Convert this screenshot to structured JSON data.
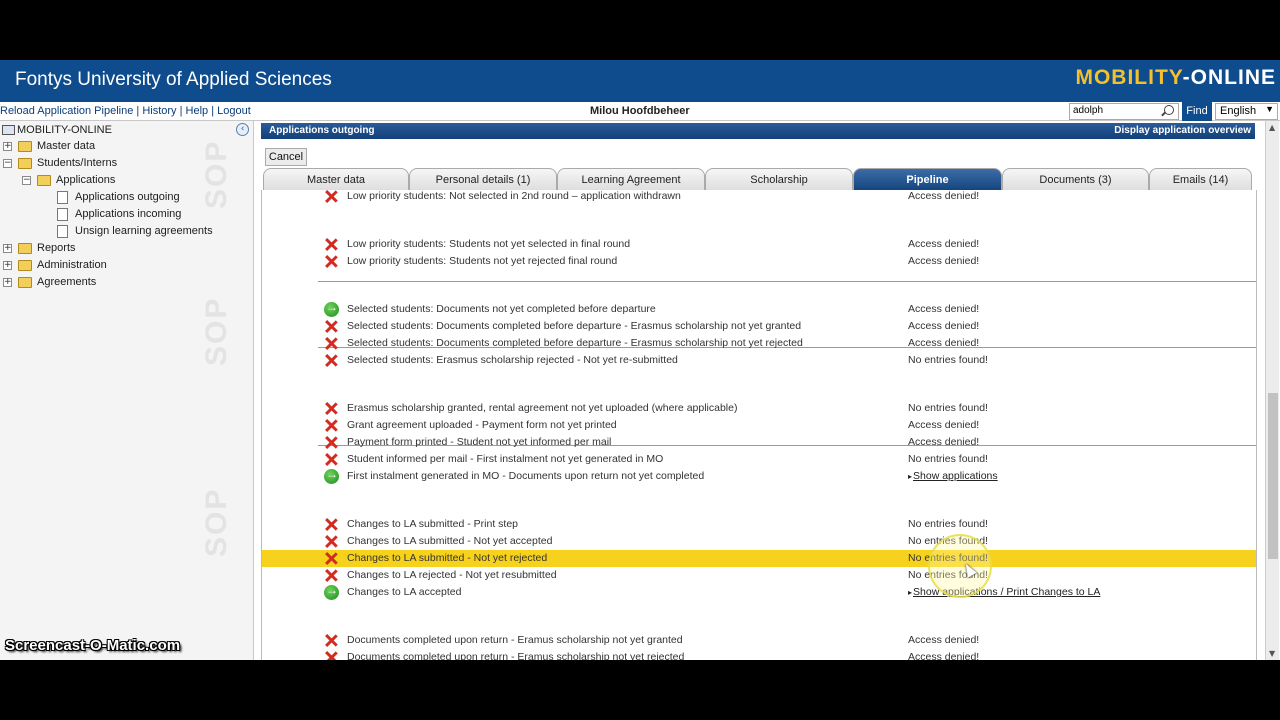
{
  "banner": {
    "title": "Fontys University of Applied Sciences",
    "logo_part1": "MOBILITY",
    "logo_dash": "-",
    "logo_part2": "ONLINE"
  },
  "topbar": {
    "links": [
      "Reload Application Pipeline",
      "History",
      "Help",
      "Logout"
    ],
    "user": "Milou Hoofdbeheer",
    "search_value": "adolph",
    "find_label": "Find",
    "language": "English"
  },
  "sidebar": {
    "root": "MOBILITY-ONLINE",
    "items": [
      "Master data",
      "Students/Interns",
      "Applications",
      "Applications outgoing",
      "Applications incoming",
      "Unsign learning agreements",
      "Reports",
      "Administration",
      "Agreements"
    ],
    "watermark": "SOP"
  },
  "main": {
    "header_left": "Applications outgoing",
    "header_right": "Display application overview",
    "cancel_label": "Cancel",
    "tabs": [
      "Master data",
      "Personal details (1)",
      "Learning Agreement",
      "Scholarship",
      "Pipeline",
      "Documents (3)",
      "Emails (14)"
    ],
    "active_tab": "Pipeline",
    "rows": [
      {
        "icon": "x",
        "label": "Low priority students: Not selected in 2nd round – application withdrawn",
        "status": "Access denied!",
        "link": false
      },
      {
        "icon": "x",
        "label": "Low priority students: Students not yet selected in final round",
        "status": "Access denied!",
        "link": false
      },
      {
        "icon": "x",
        "label": "Low priority students: Students not yet rejected final round",
        "status": "Access denied!",
        "link": false
      },
      {
        "icon": "go",
        "label": "Selected students: Documents not yet completed before departure",
        "status": "Access denied!",
        "link": false
      },
      {
        "icon": "x",
        "label": "Selected students: Documents completed before departure - Erasmus scholarship not yet granted",
        "status": "Access denied!",
        "link": false
      },
      {
        "icon": "x",
        "label": "Selected students: Documents completed before departure - Erasmus scholarship not yet rejected",
        "status": "Access denied!",
        "link": false
      },
      {
        "icon": "x",
        "label": "Selected students: Erasmus scholarship rejected - Not yet re-submitted",
        "status": "No entries found!",
        "link": false
      },
      {
        "icon": "x",
        "label": "Erasmus scholarship granted, rental agreement not yet uploaded (where applicable)",
        "status": "No entries found!",
        "link": false
      },
      {
        "icon": "x",
        "label": "Grant agreement uploaded - Payment form not yet printed",
        "status": "Access denied!",
        "link": false
      },
      {
        "icon": "x",
        "label": "Payment form printed - Student not yet informed per mail",
        "status": "Access denied!",
        "link": false
      },
      {
        "icon": "x",
        "label": "Student informed per mail - First instalment not yet generated in MO",
        "status": "No entries found!",
        "link": false
      },
      {
        "icon": "go",
        "label": "First instalment generated in MO - Documents upon return not yet completed",
        "status": "Show applications",
        "link": true
      },
      {
        "icon": "x",
        "label": "Changes to LA submitted - Print step",
        "status": "No entries found!",
        "link": false
      },
      {
        "icon": "x",
        "label": "Changes to LA submitted - Not yet accepted",
        "status": "No entries found!",
        "link": false
      },
      {
        "icon": "x",
        "label": "Changes to LA submitted - Not yet rejected",
        "status": "No entries found!",
        "link": false,
        "highlight": true
      },
      {
        "icon": "x",
        "label": "Changes to LA rejected - Not yet resubmitted",
        "status": "No entries found!",
        "link": false
      },
      {
        "icon": "go",
        "label": "Changes to LA accepted",
        "status": "Show applications / Print Changes to LA",
        "link": true
      },
      {
        "icon": "x",
        "label": "Documents completed upon return - Eramus scholarship not yet granted",
        "status": "Access denied!",
        "link": false
      },
      {
        "icon": "x",
        "label": "Documents completed upon return - Eramus scholarship not yet rejected",
        "status": "Access denied!",
        "link": false
      }
    ]
  },
  "overlay": {
    "watermark": "Screencast-O-Matic.com"
  },
  "colors": {
    "banner": "#0f4c8e",
    "logo_accent": "#f5c12b",
    "highlight": "#f7d21c",
    "x_icon": "#d22b1f",
    "go_icon": "#1c8a1c"
  }
}
